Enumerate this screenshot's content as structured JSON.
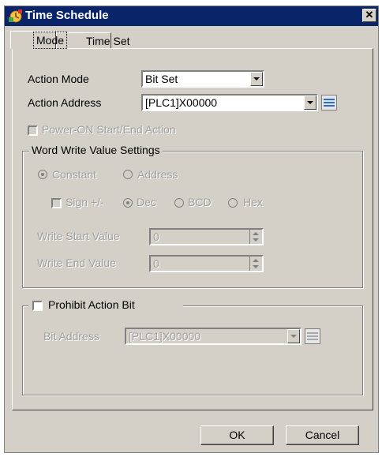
{
  "window": {
    "title": "Time Schedule",
    "close_glyph": "✕"
  },
  "tabs": [
    {
      "label": "Mode"
    },
    {
      "label": "Time Set"
    }
  ],
  "mode": {
    "action_mode_label": "Action Mode",
    "action_mode_value": "Bit Set",
    "action_address_label": "Action Address",
    "action_address_value": "[PLC1]X00000",
    "power_on_label": "Power-ON Start/End Action",
    "power_on_checked": false
  },
  "word_write": {
    "title": "Word Write Value Settings",
    "constant_label": "Constant",
    "address_label": "Address",
    "sign_label": "Sign +/-",
    "dec_label": "Dec",
    "bcd_label": "BCD",
    "hex_label": "Hex",
    "write_start_label": "Write Start Value",
    "write_start_value": "0",
    "write_end_label": "Write End Value",
    "write_end_value": "0"
  },
  "prohibit": {
    "title": "Prohibit Action Bit",
    "checked": false,
    "bit_address_label": "Bit Address",
    "bit_address_value": "[PLC1]X00000"
  },
  "buttons": {
    "ok": "OK",
    "cancel": "Cancel"
  },
  "icons": {
    "app": "schedule-icon",
    "address_picker": "input-address-icon"
  },
  "colors": {
    "titlebar": "#0a246a",
    "face": "#d4d0c8",
    "disabled_text": "#a0a0a0"
  }
}
